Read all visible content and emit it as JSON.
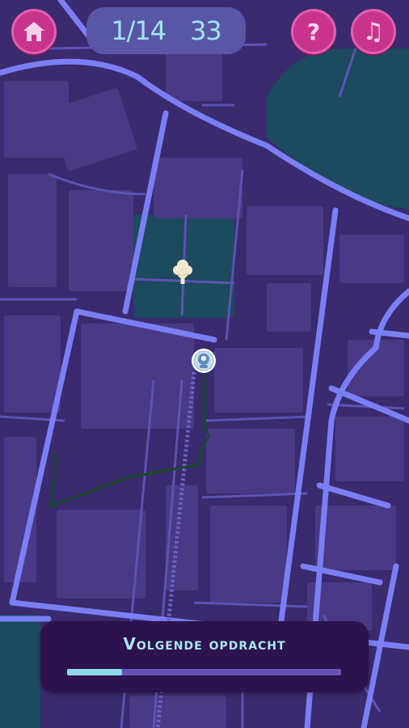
{
  "hud": {
    "counter": {
      "level": "1/14",
      "score": "33"
    }
  },
  "controls": {
    "home_icon": "home-icon",
    "help_icon": "question-mark-icon",
    "help_glyph": "?",
    "music_icon": "music-note-icon",
    "music_glyph": "♫"
  },
  "bottom_panel": {
    "next_label": "Volgende opdracht",
    "progress": 0.2
  },
  "map": {
    "markers": [
      "tree-marker",
      "player-location-marker"
    ]
  },
  "colors": {
    "map_background": "#3a2a6e",
    "road": "#7b7ff5",
    "minor_road": "#5d52b4",
    "building": "#4a3a86",
    "park": "#1c4a5e",
    "route": "#174c2a",
    "button": "#c8338c",
    "counter_bg": "#5a56a6",
    "counter_text": "#9ee5ef",
    "panel_bg": "#2c124f",
    "progress_fill": "#8fd8ee",
    "progress_track": "#6a4fb6"
  }
}
